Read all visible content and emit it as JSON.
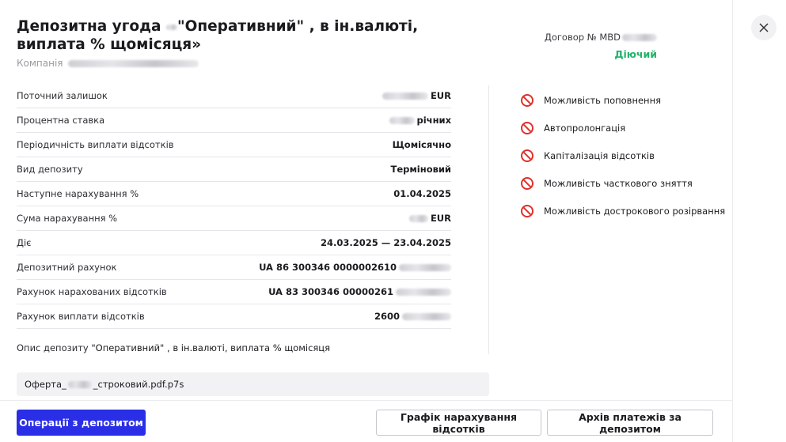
{
  "header": {
    "title_prefix": "Депозитна угода ",
    "title_main": "\"Оперативний\" , в ін.валюті, виплата % щомісяця»",
    "company_label": "Компанія",
    "contract_label": "Договор № MBD",
    "status": "Діючий"
  },
  "details": [
    {
      "label": "Поточний залишок",
      "value": "EUR"
    },
    {
      "label": "Процентна ставка",
      "value": "річних"
    },
    {
      "label": "Періодичність виплати відсотків",
      "value": "Щомісячно"
    },
    {
      "label": "Вид депозиту",
      "value": "Терміновий"
    },
    {
      "label": "Наступне нарахування %",
      "value": "01.04.2025"
    },
    {
      "label": "Сума нарахування %",
      "value": "EUR"
    },
    {
      "label": "Діє",
      "value": "24.03.2025 — 23.04.2025"
    },
    {
      "label": "Депозитний рахунок",
      "value": "UA 86 300346 0000002610"
    },
    {
      "label": "Рахунок нарахованих відсотків",
      "value": "UA 83 300346 00000261"
    },
    {
      "label": "Рахунок виплати відсотків",
      "value": "2600"
    }
  ],
  "description": {
    "label": "Опис депозиту ",
    "value": "\"Оперативний\" , в ін.валюті, виплата % щомісяця"
  },
  "features": [
    {
      "label": "Можливість поповнення",
      "icon": "prohibited-icon"
    },
    {
      "label": "Автопролонгація",
      "icon": "prohibited-icon"
    },
    {
      "label": "Капіталізація відсотків",
      "icon": "prohibited-icon"
    },
    {
      "label": "Можливість часткового зняття",
      "icon": "prohibited-icon"
    },
    {
      "label": "Можливість дострокового розірвання",
      "icon": "prohibited-icon"
    }
  ],
  "offer": {
    "prefix": "Оферта_",
    "suffix": "_строковий.pdf.p7s"
  },
  "buttons": {
    "operations": "Операції з депозитом",
    "schedule": "Графік нарахування відсотків",
    "archive": "Архів платежів за депозитом"
  },
  "colors": {
    "primary": "#2a2ee6",
    "status_active": "#21b36b",
    "prohibited": "#e0302b"
  }
}
